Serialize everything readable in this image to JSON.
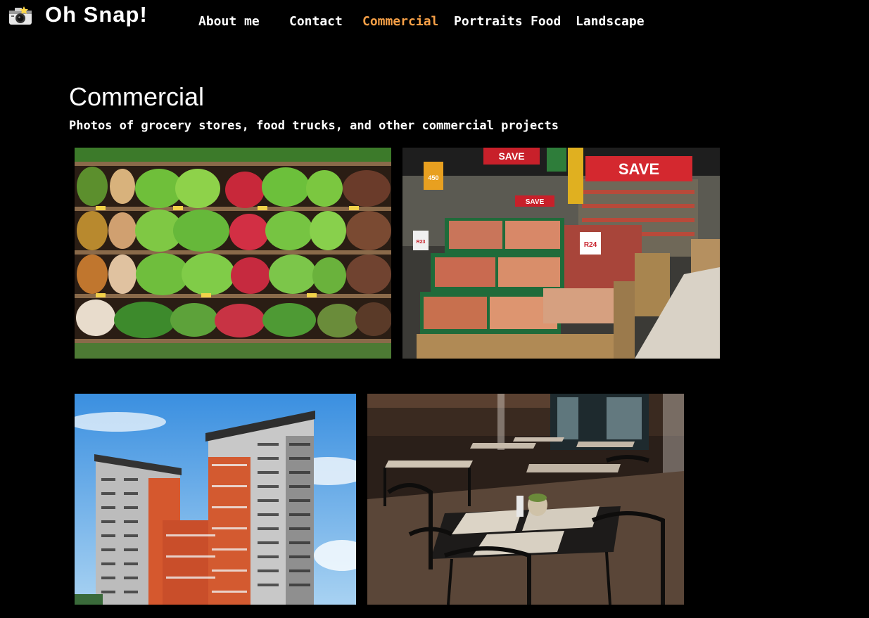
{
  "brand": {
    "name": "Oh Snap!",
    "icon": "camera-icon"
  },
  "nav": {
    "items": [
      {
        "label": "About me",
        "active": false
      },
      {
        "label": "Contact",
        "active": false
      },
      {
        "label": "Commercial",
        "active": true
      },
      {
        "label": "Portraits",
        "active": false
      },
      {
        "label": "Food",
        "active": false
      },
      {
        "label": "Landscape",
        "active": false
      }
    ],
    "active_color": "#f7a047"
  },
  "main": {
    "title": "Commercial",
    "subtitle": "Photos of grocery stores, food trucks, and other commercial projects"
  },
  "gallery": {
    "photos": [
      {
        "subject": "grocery-produce-shelves"
      },
      {
        "subject": "supermarket-fruit-displays",
        "signs": [
          "SAVE",
          "SAVE",
          "SAVE",
          "450",
          "R23",
          "R24"
        ]
      },
      {
        "subject": "apartment-building"
      },
      {
        "subject": "restaurant-interior"
      }
    ]
  },
  "colors": {
    "background": "#000000",
    "text": "#ffffff",
    "accent": "#f7a047"
  }
}
